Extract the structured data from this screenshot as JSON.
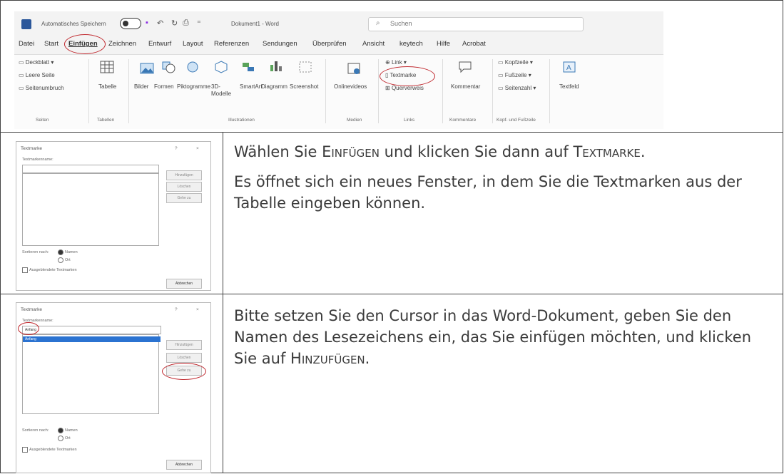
{
  "ribbon": {
    "autosave_label": "Automatisches Speichern",
    "doc_title": "Dokument1 - Word",
    "search_placeholder": "Suchen",
    "menu": [
      "Datei",
      "Start",
      "Einfügen",
      "Zeichnen",
      "Entwurf",
      "Layout",
      "Referenzen",
      "Sendungen",
      "Überprüfen",
      "Ansicht",
      "keytech",
      "Hilfe",
      "Acrobat"
    ],
    "pages": [
      "Deckblatt",
      "Leere Seite",
      "Seitenumbruch"
    ],
    "table": "Tabelle",
    "illustrations": [
      "Bilder",
      "Formen",
      "Piktogramme",
      "3D-Modelle",
      "SmartArt",
      "Diagramm",
      "Screenshot"
    ],
    "online_videos": "Onlinevideos",
    "links": [
      "Link",
      "Textmarke",
      "Querverweis"
    ],
    "comment": "Kommentar",
    "header_footer": [
      "Kopfzeile",
      "Fußzeile",
      "Seitenzahl"
    ],
    "textbox": "Textfeld",
    "groups": [
      "Seiten",
      "Tabellen",
      "Illustrationen",
      "Medien",
      "Links",
      "Kommentare",
      "Kopf- und Fußzeile"
    ]
  },
  "dialog1": {
    "title": "Textmarke",
    "name_label": "Textmarkenname:",
    "buttons": [
      "Hinzufügen",
      "Löschen",
      "Gehe zu"
    ],
    "sort_label": "Sortieren nach:",
    "sort_name": "Namen",
    "sort_ort": "Ort",
    "hidden_label": "Ausgeblendete Textmarken",
    "close": "Abbrechen"
  },
  "dialog2": {
    "title": "Textmarke",
    "name_label": "Textmarkenname:",
    "value": "Anfang",
    "list_item": "Anfang",
    "buttons": [
      "Hinzufügen",
      "Löschen",
      "Gehe zu"
    ],
    "sort_label": "Sortieren nach:",
    "sort_name": "Namen",
    "sort_ort": "Ort",
    "hidden_label": "Ausgeblendete Textmarken",
    "close": "Abbrechen"
  },
  "step1": {
    "p1_a": "Wählen Sie E",
    "p1_b": "INFÜGEN",
    "p1_c": " und klicken Sie dann auf T",
    "p1_d": "EXTMARKE",
    "p1_e": ".",
    "p2": "Es öffnet sich ein neues Fenster, in dem Sie die Textmarken aus der Tabelle eingeben können."
  },
  "step2": {
    "a": "Bitte setzen Sie den Cursor in das Word-Dokument, geben Sie den Namen des Lesezeichens ein, das Sie einfügen möchten, und klicken Sie auf H",
    "b": "INZUFÜGEN",
    "c": "."
  },
  "colors": {
    "highlight_oval": "#c0282e",
    "word_blue": "#2b579a"
  }
}
